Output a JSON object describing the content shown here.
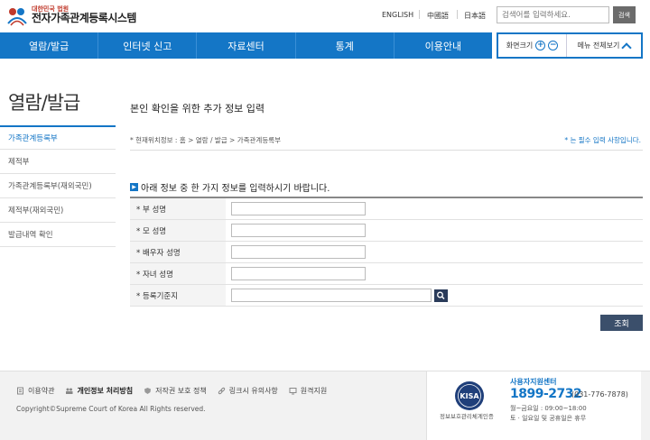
{
  "header": {
    "logo_small": "대한민국 법원",
    "logo_big": "전자가족관계등록시스템",
    "lang": [
      "ENGLISH",
      "中國語",
      "日本語"
    ],
    "search_placeholder": "검색어를 입력하세요.",
    "search_button": "검색"
  },
  "nav": {
    "items": [
      "열람/발급",
      "인터넷 신고",
      "자료센터",
      "통계",
      "이용안내"
    ],
    "zoom_label": "화면크기",
    "all_menu_label": "메뉴 전체보기"
  },
  "sidebar": {
    "title": "열람/발급",
    "items": [
      "가족관계등록부",
      "제적부",
      "가족관계등록부(재외국민)",
      "제적부(재외국민)",
      "발급내역 확인"
    ]
  },
  "main": {
    "title": "본인 확인을 위한 추가 정보 입력",
    "breadcrumb": "* 현재위치정보 : 홈 > 열람 / 발급 > 가족관계등록부",
    "required_note": "* 는 필수 입력 사항입니다.",
    "section_title": "아래 정보 중 한 가지 정보를 입력하시기 바랍니다.",
    "fields": [
      "* 부 성명",
      "* 모 성명",
      "* 배우자 성명",
      "* 자녀 성명",
      "* 등록기준지"
    ],
    "query_button": "조회"
  },
  "footer": {
    "links": [
      "이용약관",
      "개인정보 처리방침",
      "저작권 보호 정책",
      "링크시 유의사항",
      "원격지원"
    ],
    "copyright": "Copyright©Supreme Court of Korea All Rights reserved.",
    "kisa_label": "KISA",
    "kisa_caption": "정보보호관리체계인증",
    "help_title": "사용자지원센터",
    "help_phone": "1899-2732",
    "help_alt": "(031-776-7878)",
    "help_hours1": "월~금요일 : 09:00~18:00",
    "help_hours2": "토 · 일요일 및 공휴일은 휴무"
  },
  "colors": {
    "brand_blue": "#1476c6",
    "button_dark": "#3b4f6b"
  }
}
